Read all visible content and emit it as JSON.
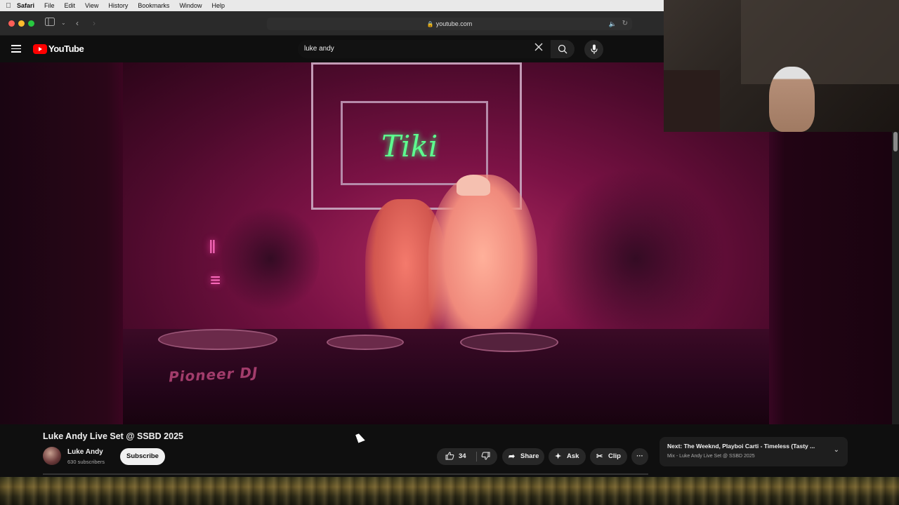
{
  "menubar": {
    "app": "Safari",
    "items": [
      "File",
      "Edit",
      "View",
      "History",
      "Bookmarks",
      "Window",
      "Help"
    ]
  },
  "browser": {
    "url": "youtube.com"
  },
  "youtube": {
    "logo_text": "YouTube",
    "search": {
      "query": "luke andy"
    }
  },
  "video": {
    "title": "Luke Andy Live Set @ SSBD 2025",
    "neon_sign_text": "Tiki",
    "console_brand_text": "Pioneer DJ"
  },
  "channel": {
    "name": "Luke Andy",
    "subscribers": "630 subscribers",
    "subscribe_label": "Subscribe"
  },
  "actions": {
    "like_count": "34",
    "share_label": "Share",
    "ask_label": "Ask",
    "clip_label": "Clip",
    "more_label": "···"
  },
  "up_next": {
    "title": "Next: The Weeknd, Playboi Carti - Timeless (Tasty ...",
    "subtitle": "Mix - Luke Andy Live Set @ SSBD 2025"
  },
  "icons": {
    "apple": "apple-icon",
    "sidebar": "sidebar-icon",
    "back": "back-arrow-icon",
    "forward": "forward-arrow-icon",
    "lock": "lock-icon",
    "audio": "speaker-icon",
    "reload": "reload-icon",
    "menu": "hamburger-icon",
    "clear": "close-icon",
    "search": "search-icon",
    "mic": "mic-icon",
    "like": "thumbs-up-icon",
    "dislike": "thumbs-down-icon",
    "share": "share-icon",
    "ask": "sparkle-icon",
    "clip": "scissors-icon",
    "chevron": "chevron-down-icon"
  },
  "colors": {
    "youtube_red": "#ff0000",
    "background": "#0f0f0f"
  }
}
